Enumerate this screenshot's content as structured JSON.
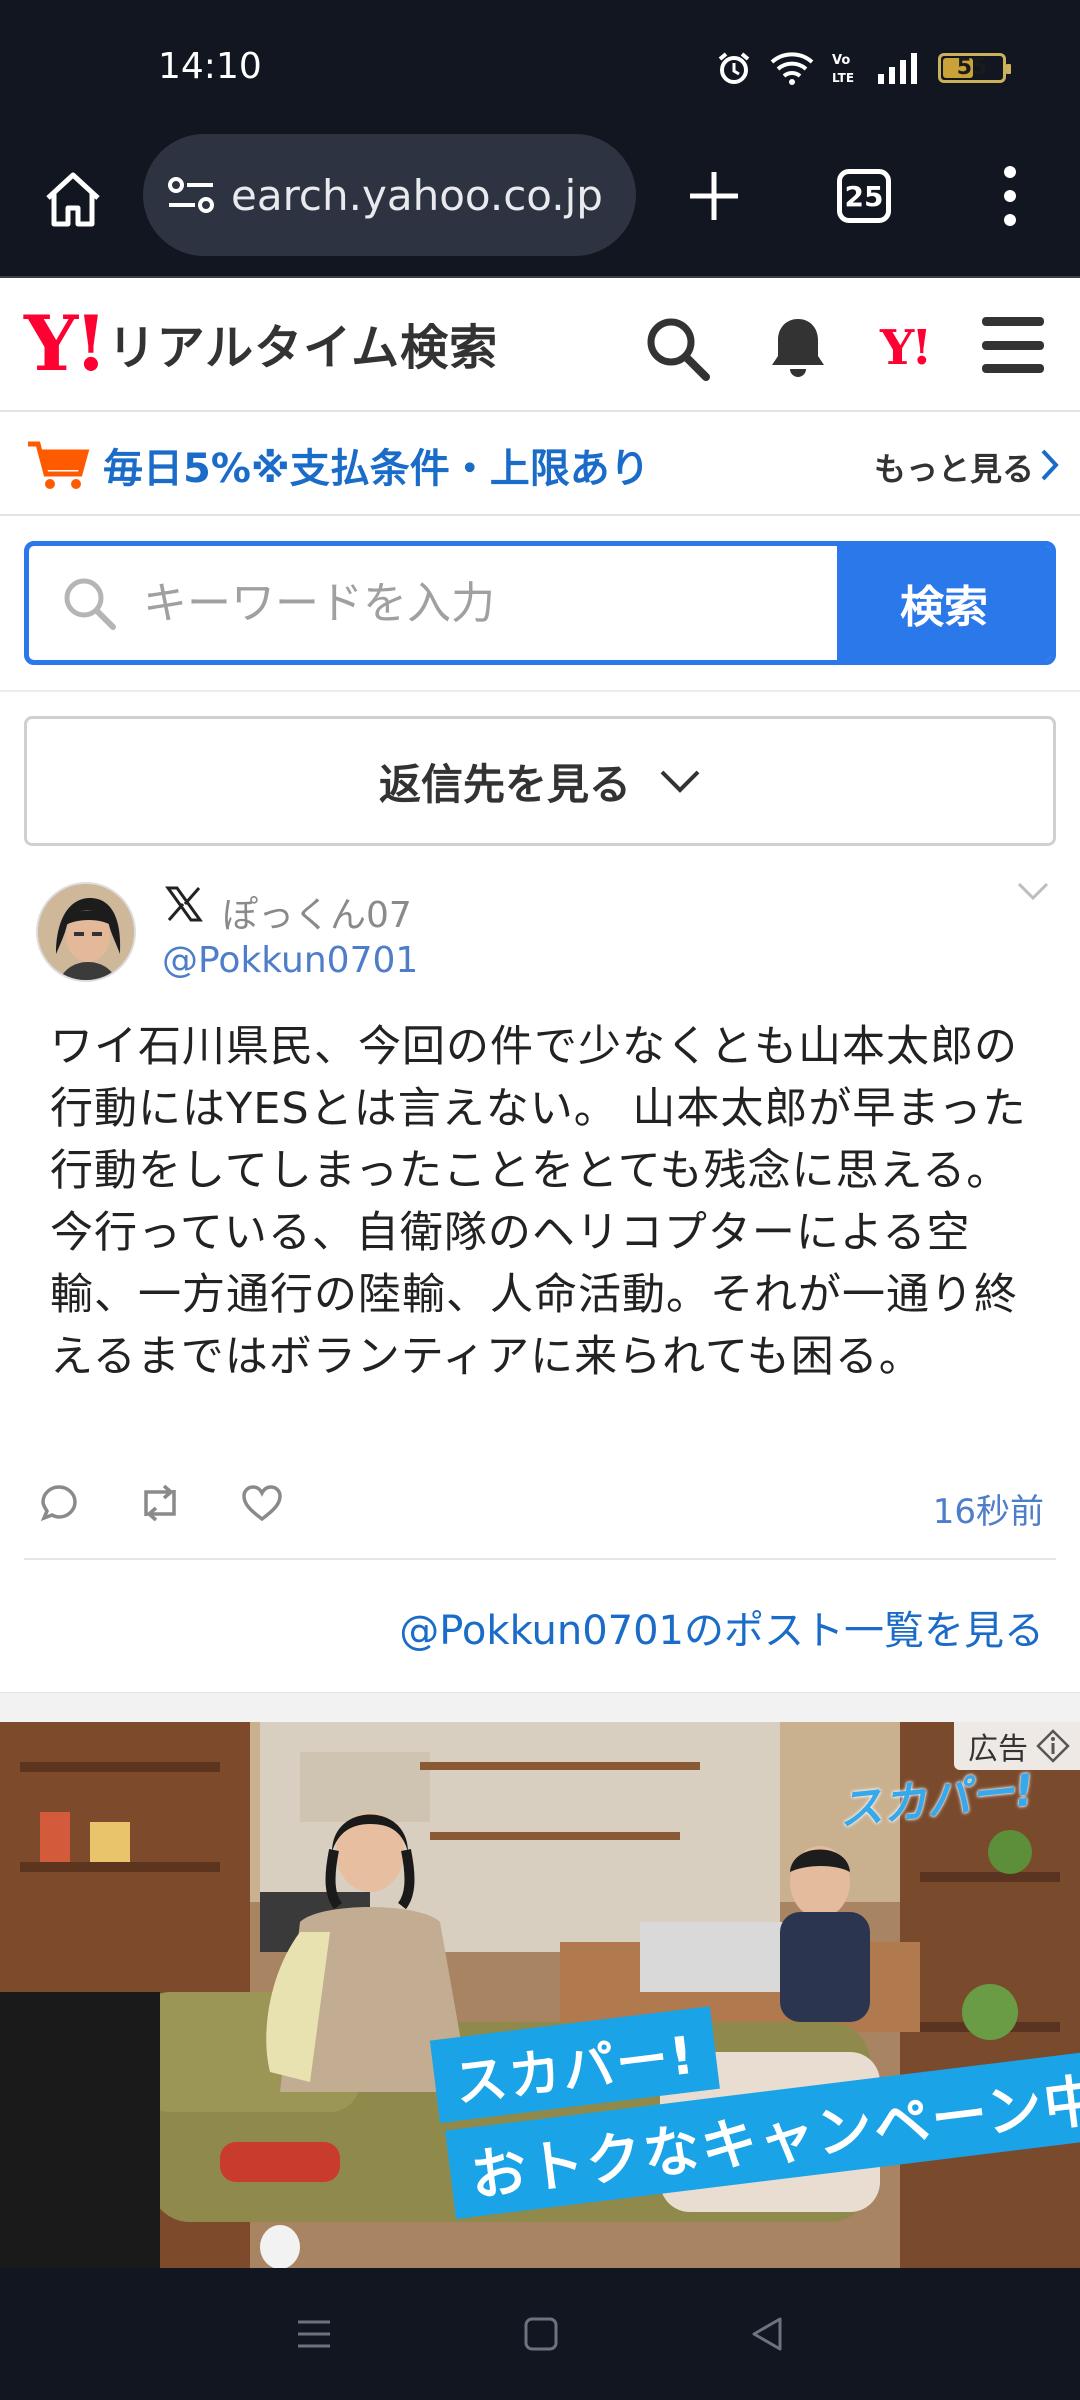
{
  "status_bar": {
    "time": "14:10",
    "battery": "55",
    "battery_level": 0.55
  },
  "browser": {
    "url": "earch.yahoo.co.jp",
    "tab_count": "25"
  },
  "site": {
    "logo_mark": "Y!",
    "title": "リアルタイム検索",
    "yj_mark": "Y!"
  },
  "promo": {
    "text": "毎日5%※支払条件・上限あり",
    "more_label": "もっと見る"
  },
  "search": {
    "placeholder": "キーワードを入力",
    "button_label": "検索"
  },
  "replies": {
    "label": "返信先を見る"
  },
  "post": {
    "display_name": "ぽっくん07",
    "handle": "@Pokkun0701",
    "body": "ワイ石川県民、今回の件で少なくとも山本太郎の行動にはYESとは言えない。 山本太郎が早まった行動をしてしまったことをとても残念に思える。 今行っている、自衛隊のヘリコプターによる空輸、一方通行の陸輸、人命活動。それが一通り終えるまではボランティアに来られても困る。",
    "time": "16秒前",
    "list_link": "@Pokkun0701のポスト一覧を見る"
  },
  "ad": {
    "label": "広告",
    "brand": "スカパー!",
    "caption_line1": "スカパー!",
    "caption_line2": "おトクなキャンペーン中!"
  },
  "icons": {
    "home": "home-icon",
    "site_info": "site-info-icon",
    "new_tab": "plus-icon",
    "tabs": "tab-switcher-icon",
    "overflow": "more-vert-icon",
    "search": "search-icon",
    "bell": "bell-icon",
    "menu": "hamburger-icon",
    "cart": "cart-icon",
    "reply": "reply-icon",
    "repost": "repost-icon",
    "like": "heart-icon"
  },
  "colors": {
    "accent": "#2b78ea",
    "yahoo_red": "#ff0033",
    "link": "#1a6cc8",
    "chrome": "#121621"
  }
}
